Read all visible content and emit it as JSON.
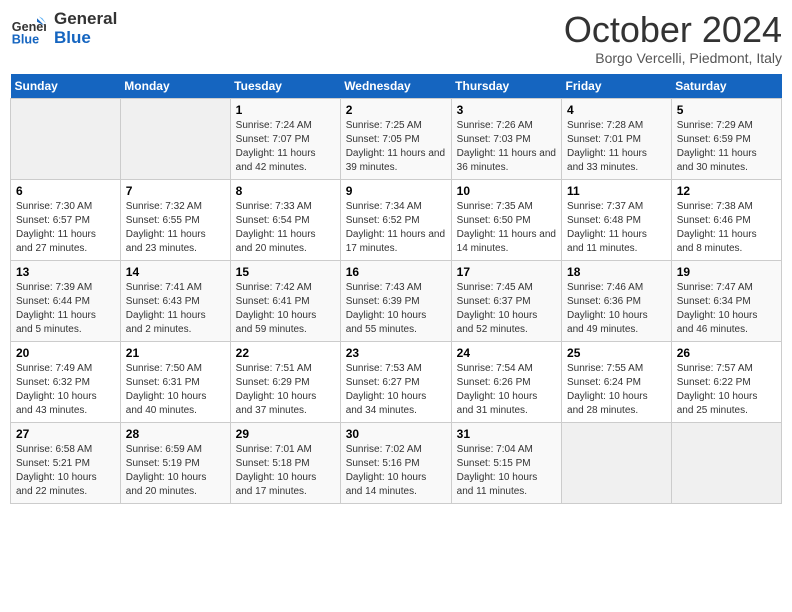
{
  "header": {
    "logo_line1": "General",
    "logo_line2": "Blue",
    "month": "October 2024",
    "location": "Borgo Vercelli, Piedmont, Italy"
  },
  "columns": [
    "Sunday",
    "Monday",
    "Tuesday",
    "Wednesday",
    "Thursday",
    "Friday",
    "Saturday"
  ],
  "weeks": [
    [
      {
        "day": "",
        "info": ""
      },
      {
        "day": "",
        "info": ""
      },
      {
        "day": "1",
        "sunrise": "7:24 AM",
        "sunset": "7:07 PM",
        "daylight": "11 hours and 42 minutes."
      },
      {
        "day": "2",
        "sunrise": "7:25 AM",
        "sunset": "7:05 PM",
        "daylight": "11 hours and 39 minutes."
      },
      {
        "day": "3",
        "sunrise": "7:26 AM",
        "sunset": "7:03 PM",
        "daylight": "11 hours and 36 minutes."
      },
      {
        "day": "4",
        "sunrise": "7:28 AM",
        "sunset": "7:01 PM",
        "daylight": "11 hours and 33 minutes."
      },
      {
        "day": "5",
        "sunrise": "7:29 AM",
        "sunset": "6:59 PM",
        "daylight": "11 hours and 30 minutes."
      }
    ],
    [
      {
        "day": "6",
        "sunrise": "7:30 AM",
        "sunset": "6:57 PM",
        "daylight": "11 hours and 27 minutes."
      },
      {
        "day": "7",
        "sunrise": "7:32 AM",
        "sunset": "6:55 PM",
        "daylight": "11 hours and 23 minutes."
      },
      {
        "day": "8",
        "sunrise": "7:33 AM",
        "sunset": "6:54 PM",
        "daylight": "11 hours and 20 minutes."
      },
      {
        "day": "9",
        "sunrise": "7:34 AM",
        "sunset": "6:52 PM",
        "daylight": "11 hours and 17 minutes."
      },
      {
        "day": "10",
        "sunrise": "7:35 AM",
        "sunset": "6:50 PM",
        "daylight": "11 hours and 14 minutes."
      },
      {
        "day": "11",
        "sunrise": "7:37 AM",
        "sunset": "6:48 PM",
        "daylight": "11 hours and 11 minutes."
      },
      {
        "day": "12",
        "sunrise": "7:38 AM",
        "sunset": "6:46 PM",
        "daylight": "11 hours and 8 minutes."
      }
    ],
    [
      {
        "day": "13",
        "sunrise": "7:39 AM",
        "sunset": "6:44 PM",
        "daylight": "11 hours and 5 minutes."
      },
      {
        "day": "14",
        "sunrise": "7:41 AM",
        "sunset": "6:43 PM",
        "daylight": "11 hours and 2 minutes."
      },
      {
        "day": "15",
        "sunrise": "7:42 AM",
        "sunset": "6:41 PM",
        "daylight": "10 hours and 59 minutes."
      },
      {
        "day": "16",
        "sunrise": "7:43 AM",
        "sunset": "6:39 PM",
        "daylight": "10 hours and 55 minutes."
      },
      {
        "day": "17",
        "sunrise": "7:45 AM",
        "sunset": "6:37 PM",
        "daylight": "10 hours and 52 minutes."
      },
      {
        "day": "18",
        "sunrise": "7:46 AM",
        "sunset": "6:36 PM",
        "daylight": "10 hours and 49 minutes."
      },
      {
        "day": "19",
        "sunrise": "7:47 AM",
        "sunset": "6:34 PM",
        "daylight": "10 hours and 46 minutes."
      }
    ],
    [
      {
        "day": "20",
        "sunrise": "7:49 AM",
        "sunset": "6:32 PM",
        "daylight": "10 hours and 43 minutes."
      },
      {
        "day": "21",
        "sunrise": "7:50 AM",
        "sunset": "6:31 PM",
        "daylight": "10 hours and 40 minutes."
      },
      {
        "day": "22",
        "sunrise": "7:51 AM",
        "sunset": "6:29 PM",
        "daylight": "10 hours and 37 minutes."
      },
      {
        "day": "23",
        "sunrise": "7:53 AM",
        "sunset": "6:27 PM",
        "daylight": "10 hours and 34 minutes."
      },
      {
        "day": "24",
        "sunrise": "7:54 AM",
        "sunset": "6:26 PM",
        "daylight": "10 hours and 31 minutes."
      },
      {
        "day": "25",
        "sunrise": "7:55 AM",
        "sunset": "6:24 PM",
        "daylight": "10 hours and 28 minutes."
      },
      {
        "day": "26",
        "sunrise": "7:57 AM",
        "sunset": "6:22 PM",
        "daylight": "10 hours and 25 minutes."
      }
    ],
    [
      {
        "day": "27",
        "sunrise": "6:58 AM",
        "sunset": "5:21 PM",
        "daylight": "10 hours and 22 minutes."
      },
      {
        "day": "28",
        "sunrise": "6:59 AM",
        "sunset": "5:19 PM",
        "daylight": "10 hours and 20 minutes."
      },
      {
        "day": "29",
        "sunrise": "7:01 AM",
        "sunset": "5:18 PM",
        "daylight": "10 hours and 17 minutes."
      },
      {
        "day": "30",
        "sunrise": "7:02 AM",
        "sunset": "5:16 PM",
        "daylight": "10 hours and 14 minutes."
      },
      {
        "day": "31",
        "sunrise": "7:04 AM",
        "sunset": "5:15 PM",
        "daylight": "10 hours and 11 minutes."
      },
      {
        "day": "",
        "info": ""
      },
      {
        "day": "",
        "info": ""
      }
    ]
  ]
}
